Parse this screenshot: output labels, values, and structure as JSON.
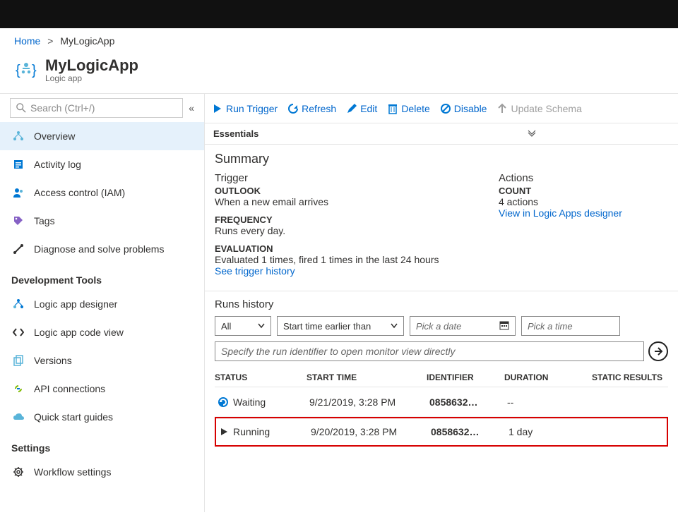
{
  "breadcrumb": {
    "home": "Home",
    "current": "MyLogicApp"
  },
  "header": {
    "title": "MyLogicApp",
    "subtitle": "Logic app"
  },
  "search": {
    "placeholder": "Search (Ctrl+/)"
  },
  "nav": {
    "overview": "Overview",
    "activity_log": "Activity log",
    "access_control": "Access control (IAM)",
    "tags": "Tags",
    "diagnose": "Diagnose and solve problems",
    "section_dev": "Development Tools",
    "designer": "Logic app designer",
    "code_view": "Logic app code view",
    "versions": "Versions",
    "api_connections": "API connections",
    "quick_start": "Quick start guides",
    "section_settings": "Settings",
    "workflow_settings": "Workflow settings"
  },
  "toolbar": {
    "run_trigger": "Run Trigger",
    "refresh": "Refresh",
    "edit": "Edit",
    "delete": "Delete",
    "disable": "Disable",
    "update_schema": "Update Schema"
  },
  "essentials": {
    "label": "Essentials"
  },
  "summary": {
    "title": "Summary",
    "trigger_label": "Trigger",
    "actions_label": "Actions",
    "outlook_head": "OUTLOOK",
    "outlook_text": "When a new email arrives",
    "frequency_head": "FREQUENCY",
    "frequency_text": "Runs every day.",
    "evaluation_head": "EVALUATION",
    "evaluation_text": "Evaluated 1 times, fired 1 times in the last 24 hours",
    "see_trigger_history": "See trigger history",
    "count_head": "COUNT",
    "count_text": "4 actions",
    "view_designer": "View in Logic Apps designer"
  },
  "runs": {
    "title": "Runs history",
    "filter_all": "All",
    "filter_start": "Start time earlier than",
    "pick_date": "Pick a date",
    "pick_time": "Pick a time",
    "identifier_placeholder": "Specify the run identifier to open monitor view directly",
    "cols": {
      "status": "STATUS",
      "start": "START TIME",
      "id": "IDENTIFIER",
      "dur": "DURATION",
      "static": "STATIC RESULTS"
    },
    "rows": [
      {
        "status": "Waiting",
        "start": "9/21/2019, 3:28 PM",
        "id": "0858632…",
        "dur": "--",
        "icon": "waiting",
        "highlight": false
      },
      {
        "status": "Running",
        "start": "9/20/2019, 3:28 PM",
        "id": "0858632…",
        "dur": "1 day",
        "icon": "running",
        "highlight": true
      }
    ]
  }
}
